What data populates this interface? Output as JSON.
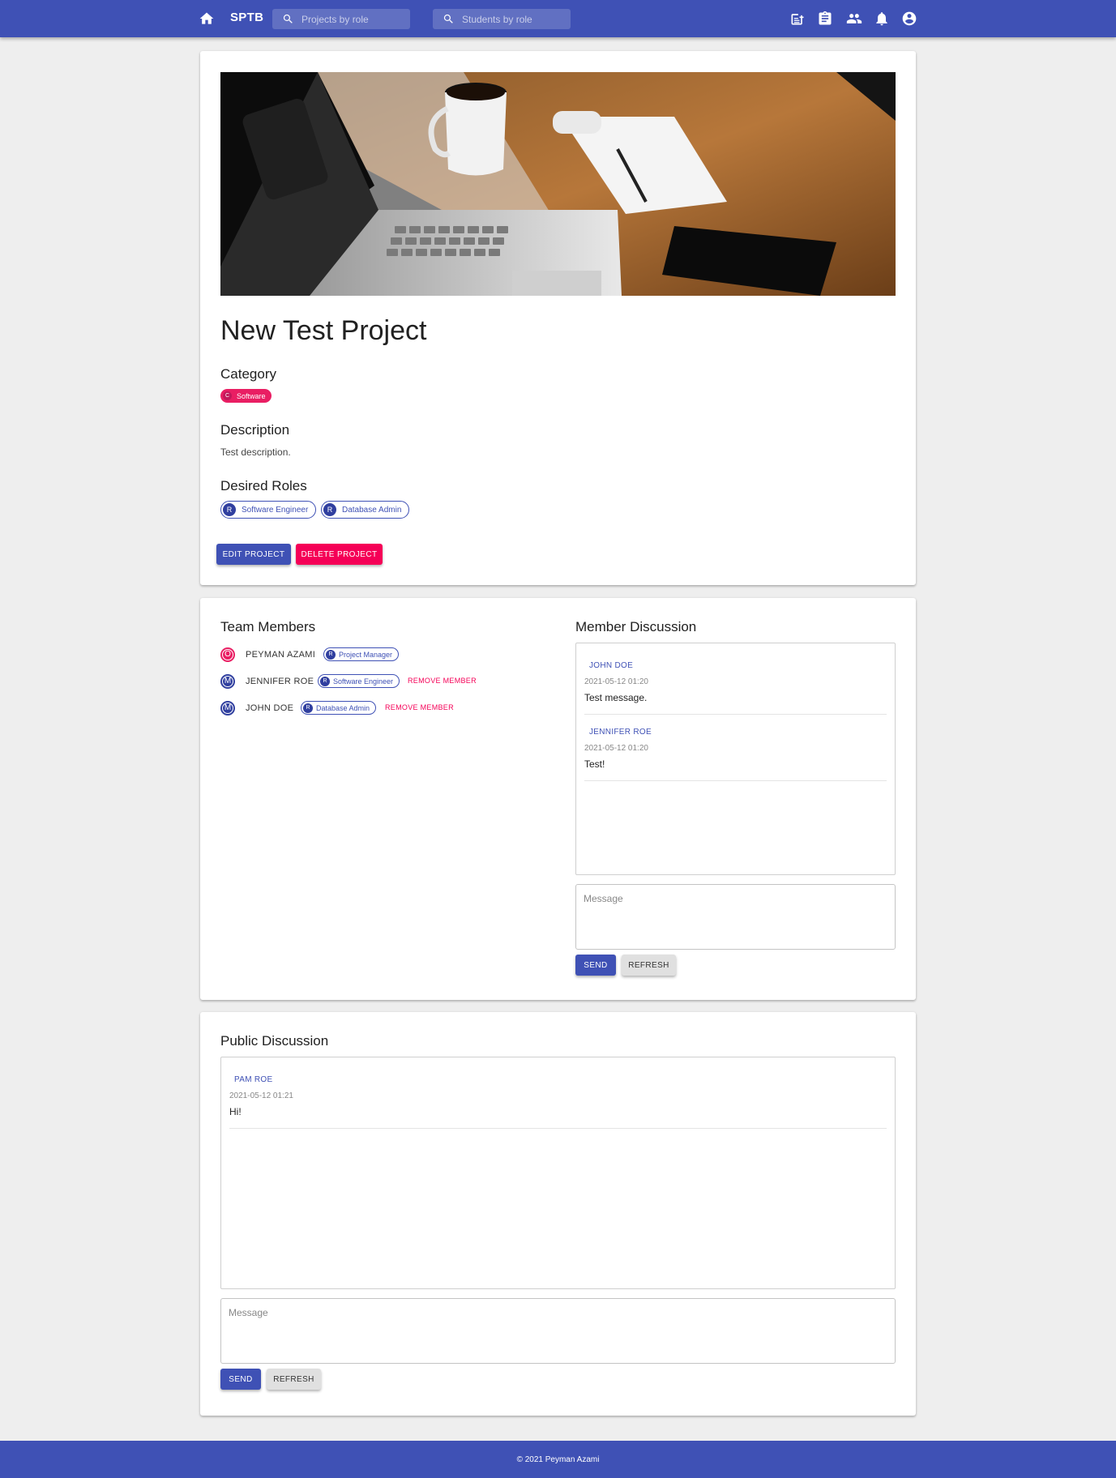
{
  "appbar": {
    "brand": "SPTB",
    "search_projects_placeholder": "Projects by role",
    "search_students_placeholder": "Students by role",
    "icons": [
      "home-icon",
      "create-project-icon",
      "assignment-icon",
      "people-icon",
      "notifications-icon",
      "account-circle-icon"
    ]
  },
  "colors": {
    "primary": "#3f51b5",
    "secondary": "#f50057",
    "background": "#eeeeee"
  },
  "project": {
    "title": "New Test Project",
    "category_heading": "Category",
    "category_avatar": "C",
    "category": "Software",
    "description_heading": "Description",
    "description": "Test description.",
    "roles_heading": "Desired Roles",
    "roles": [
      {
        "avatar": "R",
        "label": "Software Engineer"
      },
      {
        "avatar": "R",
        "label": "Database Admin"
      }
    ],
    "edit_label": "EDIT PROJECT",
    "delete_label": "DELETE PROJECT"
  },
  "team": {
    "heading": "Team Members",
    "members": [
      {
        "icon": "O",
        "name": "PEYMAN AZAMI",
        "role_avatar": "R",
        "role": "Project Manager",
        "action": ""
      },
      {
        "icon": "M",
        "name": "JENNIFER ROE",
        "role_avatar": "R",
        "role": "Software Engineer",
        "action": "REMOVE MEMBER"
      },
      {
        "icon": "M",
        "name": "JOHN DOE",
        "role_avatar": "R",
        "role": "Database Admin",
        "action": "REMOVE MEMBER"
      }
    ]
  },
  "member_discussion": {
    "heading": "Member Discussion",
    "messages": [
      {
        "author": "JOHN DOE",
        "time": "2021-05-12 01:20",
        "text": "Test message."
      },
      {
        "author": "JENNIFER ROE",
        "time": "2021-05-12 01:20",
        "text": "Test!"
      }
    ],
    "input_placeholder": "Message",
    "send_label": "SEND",
    "refresh_label": "REFRESH"
  },
  "public_discussion": {
    "heading": "Public Discussion",
    "messages": [
      {
        "author": "PAM ROE",
        "time": "2021-05-12 01:21",
        "text": "Hi!"
      }
    ],
    "input_placeholder": "Message",
    "send_label": "SEND",
    "refresh_label": "REFRESH"
  },
  "footer": {
    "text": "© 2021 Peyman Azami"
  }
}
